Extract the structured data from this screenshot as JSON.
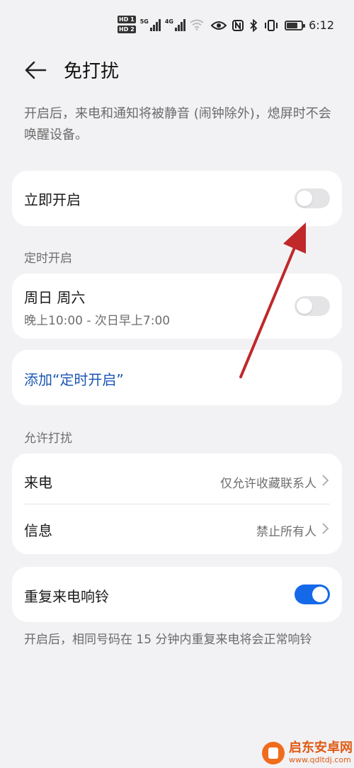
{
  "status_bar": {
    "hd1": "HD 1",
    "hd2": "HD 2",
    "net1": "5G",
    "net2": "4G",
    "time": "6:12",
    "battery_level": 0.75
  },
  "header": {
    "title": "免打扰"
  },
  "intro_text": "开启后，来电和通知将被静音 (闹钟除外)，熄屏时不会唤醒设备。",
  "immediate": {
    "label": "立即开启",
    "enabled": false
  },
  "schedule": {
    "section_label": "定时开启",
    "item_title": "周日 周六",
    "item_time": "晚上10:00 - 次日早上7:00",
    "enabled": false,
    "add_label": "添加“定时开启”"
  },
  "allow": {
    "section_label": "允许打扰",
    "rows": [
      {
        "label": "来电",
        "value": "仅允许收藏联系人"
      },
      {
        "label": "信息",
        "value": "禁止所有人"
      }
    ]
  },
  "repeat_call": {
    "label": "重复来电响铃",
    "enabled": true,
    "note": "开启后，相同号码在 15 分钟内重复来电将会正常响铃"
  },
  "watermark": {
    "name": "启东安卓网",
    "url": "www.qdltdj.com"
  },
  "colors": {
    "accent": "#1569e8",
    "link": "#1a56b3",
    "annotation_arrow": "#c0282a",
    "background": "#f2f2f4"
  },
  "icons": {
    "back": "arrow-left-icon",
    "chevron": "chevron-right-icon",
    "eye": "eye-icon",
    "nfc": "nfc-icon",
    "bluetooth": "bluetooth-icon",
    "vibrate": "vibrate-icon",
    "wifi": "wifi-icon",
    "battery": "battery-icon"
  }
}
